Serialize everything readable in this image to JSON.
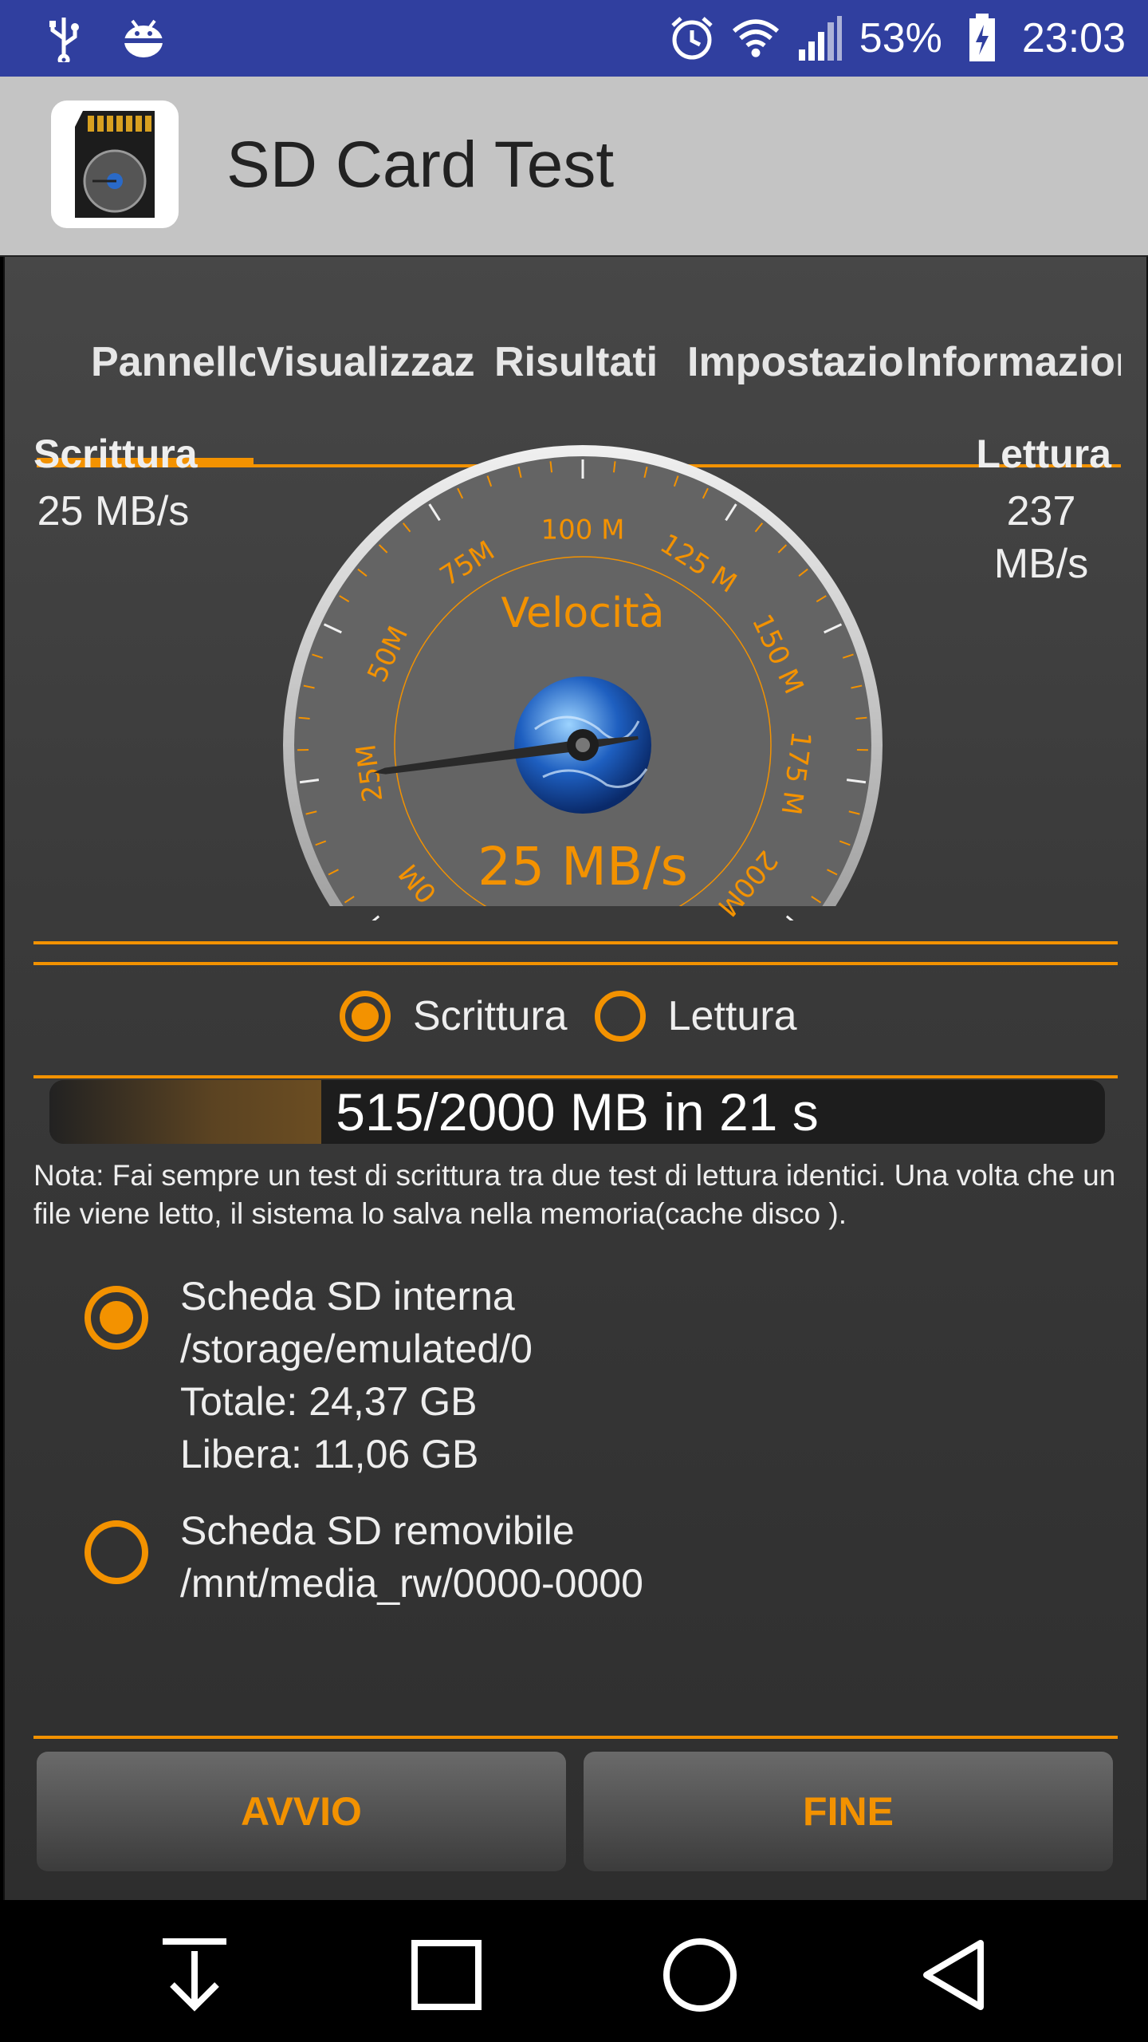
{
  "status_bar": {
    "battery_percent": "53%",
    "time": "23:03",
    "icons": [
      "usb-icon",
      "android-debug-icon",
      "alarm-icon",
      "wifi-icon",
      "signal-icon",
      "battery-charging-icon"
    ]
  },
  "app": {
    "title": "SD Card Test"
  },
  "tabs": [
    "Pannello",
    "Visualizzazione",
    "Risultati",
    "Impostazioni",
    "Informazioni"
  ],
  "write": {
    "label": "Scrittura",
    "value": "25 MB/s"
  },
  "read": {
    "label": "Lettura",
    "value": "237 MB/s"
  },
  "gauge": {
    "title": "Velocità",
    "readout": "25 MB/s",
    "ticks": [
      "0M",
      "25M",
      "50M",
      "75M",
      "100 M",
      "125 M",
      "150 M",
      "175 M",
      "200M"
    ],
    "min": 0,
    "max": 200,
    "value": 25
  },
  "mode": {
    "write_label": "Scrittura",
    "read_label": "Lettura",
    "selected": "Scrittura"
  },
  "progress": {
    "text": "515/2000 MB in 21 s",
    "done": 515,
    "total": 2000
  },
  "note": "Nota: Fai sempre un test di scrittura tra due test di lettura identici. Una volta che un file viene letto, il sistema lo salva nella memoria(cache disco ).",
  "storage": [
    {
      "name": "Scheda SD interna",
      "path": "/storage/emulated/0",
      "total": "Totale: 24,37 GB",
      "free": "Libera: 11,06 GB",
      "selected": true
    },
    {
      "name": "Scheda SD removibile",
      "path": "/mnt/media_rw/0000-0000",
      "selected": false
    }
  ],
  "buttons": {
    "start": "AVVIO",
    "stop": "FINE"
  },
  "colors": {
    "accent": "#f39200",
    "status_bar": "#303F9F",
    "title_bar": "#c4c4c4"
  }
}
